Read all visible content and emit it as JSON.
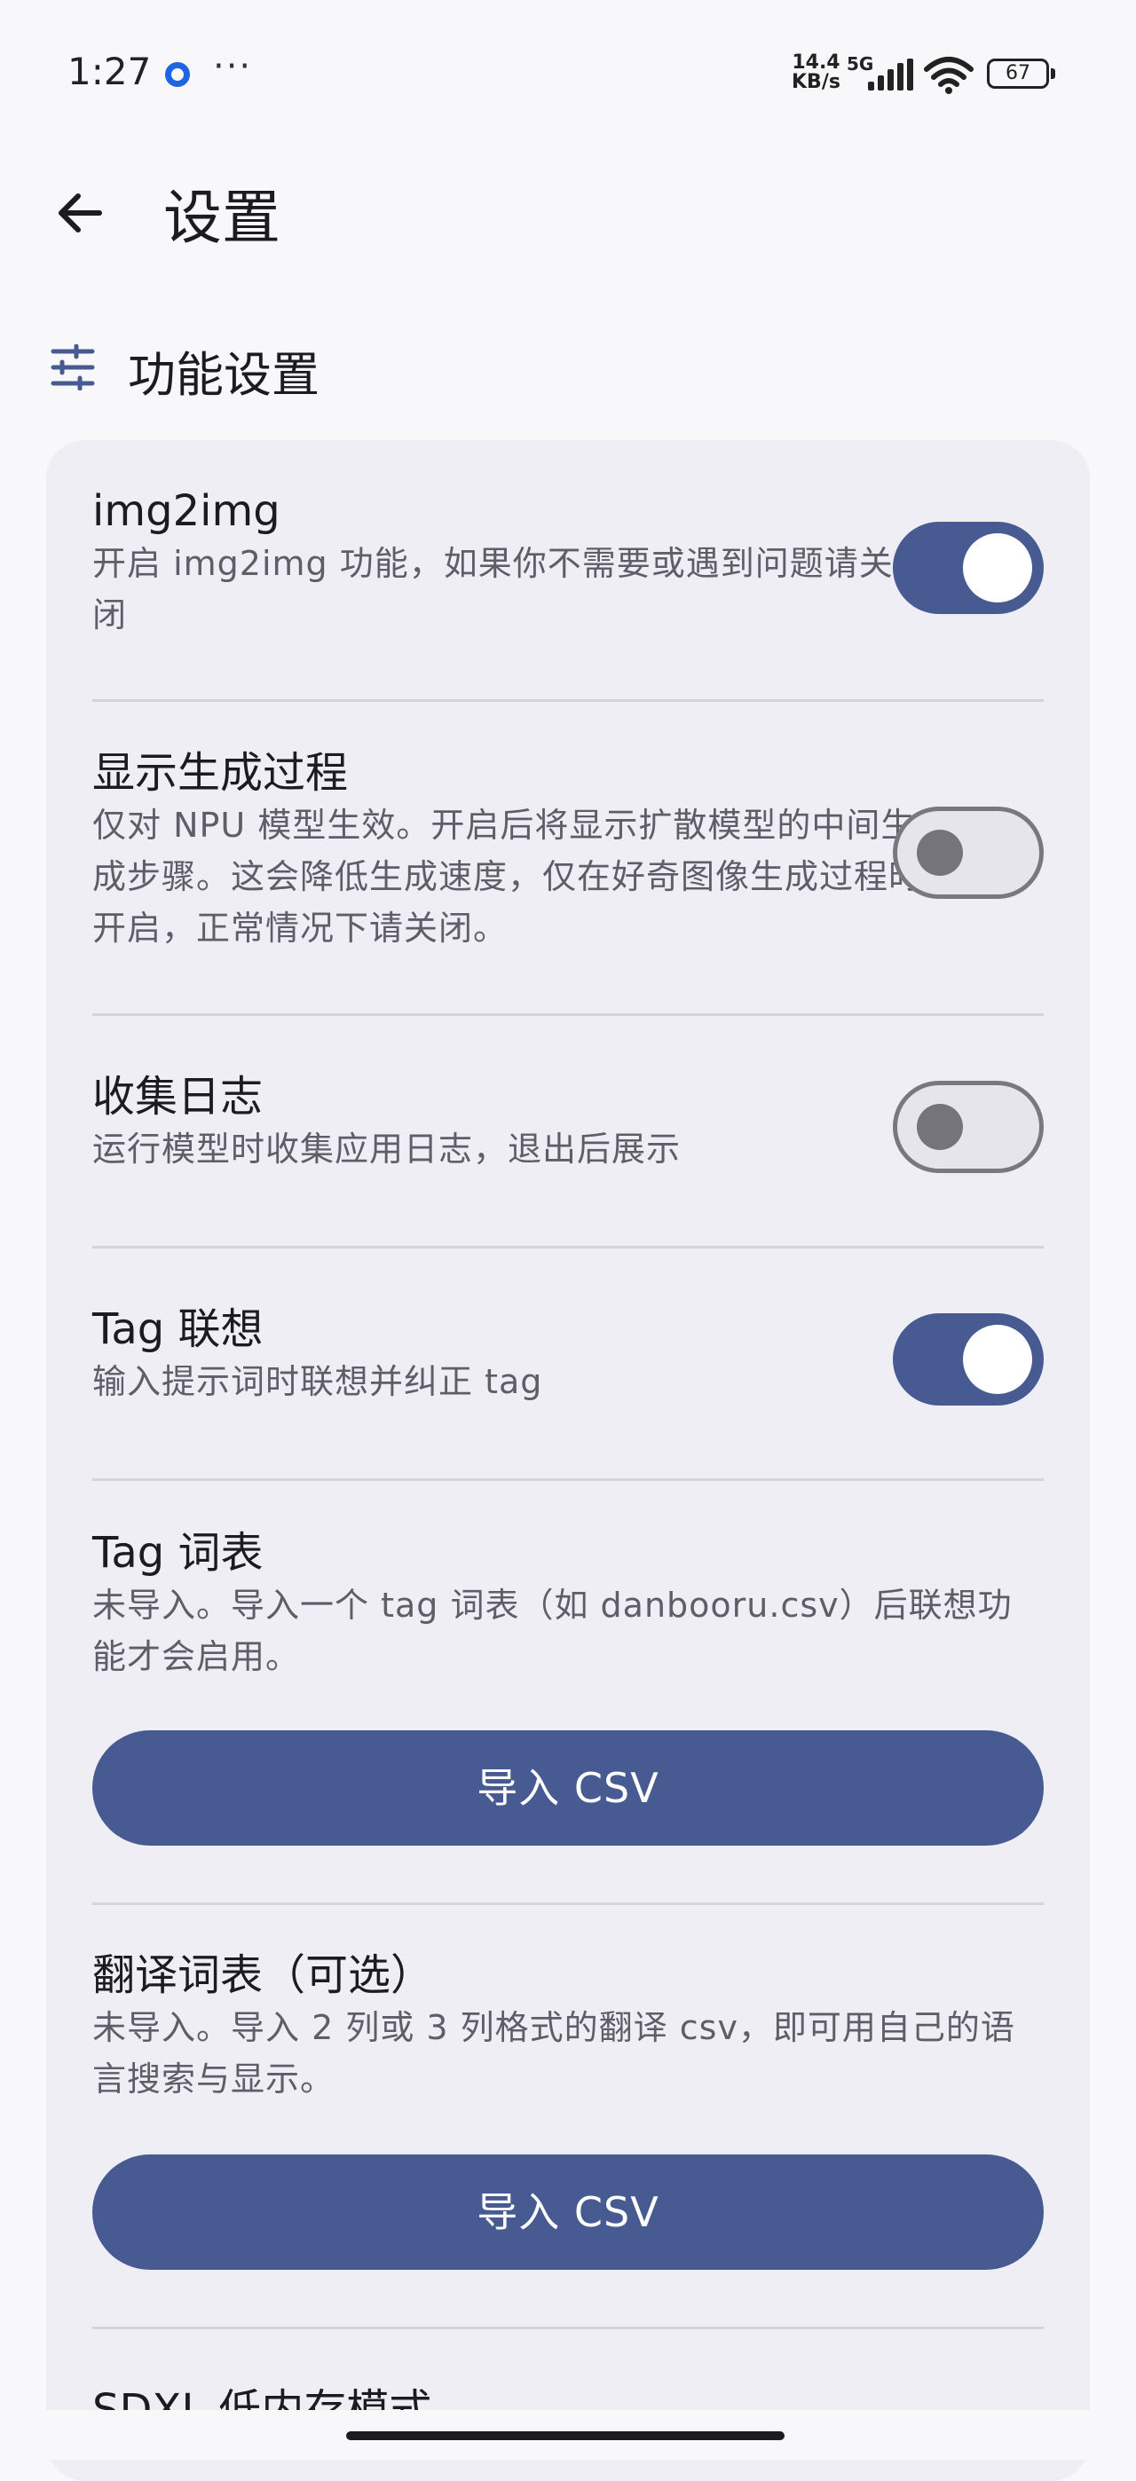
{
  "status_bar": {
    "time": "1:27",
    "more": "···",
    "net_speed_value": "14.4",
    "net_speed_unit": "KB/s",
    "network_type": "5G",
    "battery": "67",
    "icons": [
      "app-notification-icon",
      "signal-icon",
      "wifi-icon",
      "battery-icon"
    ]
  },
  "app_bar": {
    "title": "设置",
    "back_icon": "arrow-back-icon"
  },
  "section": {
    "icon": "tune-sliders-icon",
    "title": "功能设置"
  },
  "settings": [
    {
      "title": "img2img",
      "description": "开启 img2img 功能，如果你不需要或遇到问题请关闭",
      "enabled": true
    },
    {
      "title": "显示生成过程",
      "description": "仅对 NPU 模型生效。开启后将显示扩散模型的中间生成步骤。这会降低生成速度，仅在好奇图像生成过程时开启，正常情况下请关闭。",
      "enabled": false
    },
    {
      "title": "收集日志",
      "description": "运行模型时收集应用日志，退出后展示",
      "enabled": false
    },
    {
      "title": "Tag 联想",
      "description": "输入提示词时联想并纠正 tag",
      "enabled": true
    },
    {
      "title": "Tag 词表",
      "description": "未导入。导入一个 tag 词表（如 danbooru.csv）后联想功能才会启用。",
      "button_label": "导入 CSV"
    },
    {
      "title": "翻译词表（可选）",
      "description": "未导入。导入 2 列或 3 列格式的翻译 csv，即可用自己的语言搜索与显示。",
      "button_label": "导入 CSV"
    },
    {
      "title": "SDXL 低内存模式"
    }
  ],
  "colors": {
    "accent": "#475a91",
    "card_background": "#eeeef4",
    "page_background": "#f8f8fb"
  }
}
